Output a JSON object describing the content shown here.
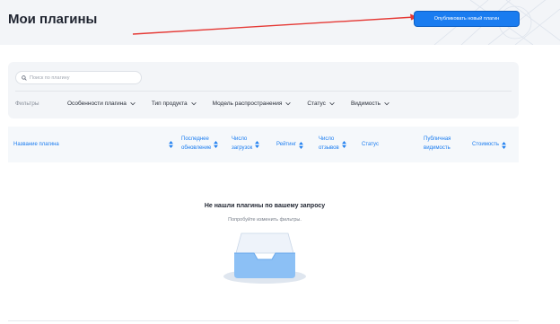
{
  "header": {
    "title": "Мои плагины",
    "publish_label": "Опубликовать новый плагин"
  },
  "search": {
    "placeholder": "Поиск по плагину"
  },
  "filters": {
    "label": "Фильтры",
    "items": [
      {
        "label": "Особенности плагина"
      },
      {
        "label": "Тип продукта"
      },
      {
        "label": "Модель распространения"
      },
      {
        "label": "Статус"
      },
      {
        "label": "Видимость"
      }
    ]
  },
  "table": {
    "columns": [
      {
        "line1": "Название плагина",
        "line2": ""
      },
      {
        "line1": "Последнее",
        "line2": "обновление"
      },
      {
        "line1": "Число",
        "line2": "загрузок"
      },
      {
        "line1": "Рейтинг",
        "line2": ""
      },
      {
        "line1": "Число",
        "line2": "отзывов"
      },
      {
        "line1": "Статус",
        "line2": ""
      },
      {
        "line1": "Публичная",
        "line2": "видимость"
      },
      {
        "line1": "Стоимость",
        "line2": ""
      }
    ]
  },
  "empty_state": {
    "title": "Не нашли плагины по вашему запросу",
    "subtitle": "Попробуйте изменить фильтры."
  },
  "colors": {
    "accent": "#1a7cf0",
    "annotation_arrow": "#e53935"
  }
}
